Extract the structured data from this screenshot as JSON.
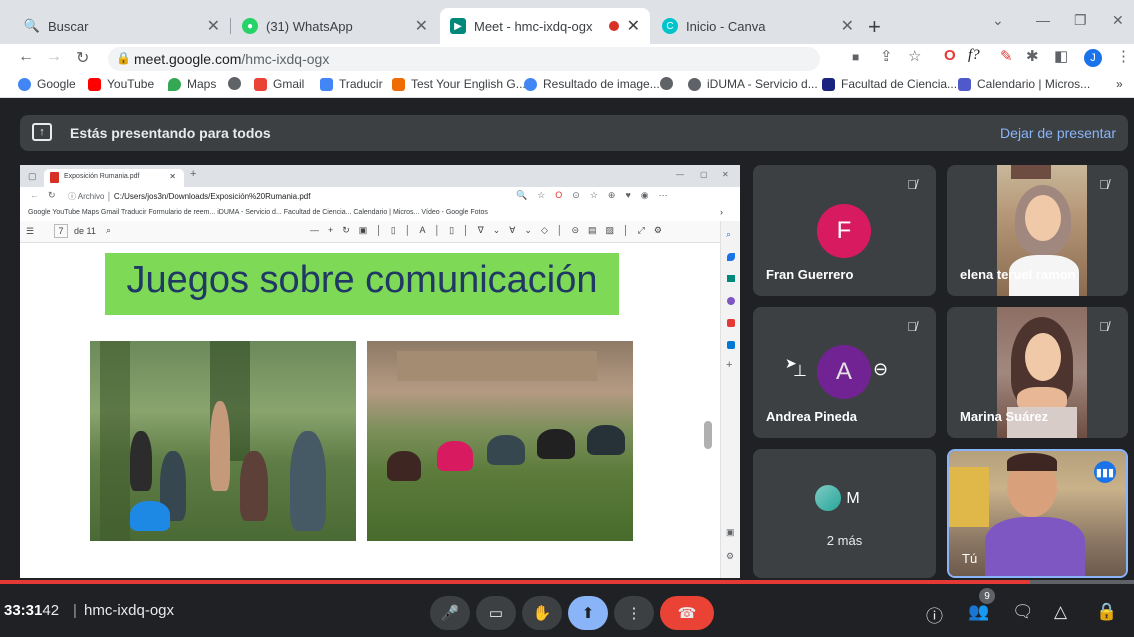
{
  "browser": {
    "tabs": [
      {
        "label": "Buscar",
        "color": "#1a73e8"
      },
      {
        "label": "(31) WhatsApp",
        "color": "#25d366"
      },
      {
        "label": "Meet - hmc-ixdq-ogx",
        "color": "#00897b"
      },
      {
        "label": "Inicio - Canva",
        "color": "#00c4cc"
      }
    ],
    "url_domain": "meet.google.com",
    "url_path": "/hmc-ixdq-ogx",
    "profile_initial": "J",
    "bookmarks": [
      "Google",
      "YouTube",
      "Maps",
      "Gmail",
      "Traducir",
      "Test Your English G...",
      "Resultado de image...",
      "iDUMA - Servicio d...",
      "Facultad de Ciencia...",
      "Calendario | Micros..."
    ]
  },
  "meet": {
    "presenting_text": "Estás presentando para todos",
    "stop_presenting": "Dejar de presentar",
    "participants": [
      {
        "name": "Fran Guerrero",
        "initial": "F",
        "color": "#d81b60"
      },
      {
        "name": "elena teruel ramon"
      },
      {
        "name": "Andrea Pineda",
        "initial": "A",
        "color": "#7b1fa2"
      },
      {
        "name": "Marina Suárez"
      },
      {
        "name": "2 más",
        "initial": "M",
        "color": "#4e342e"
      },
      {
        "name": "Tú"
      }
    ],
    "meeting_code": "hmc-ixdq-ogx",
    "time": "33:31",
    "time_overlap": "42",
    "participant_count": "9"
  },
  "shared": {
    "tab_label": "Exposición Rumania.pdf",
    "path": "C:/Users/jos3n/Downloads/Exposición%20Rumania.pdf",
    "archivo": "Archivo",
    "page_current": "7",
    "page_total": "de 11",
    "bookmarks": "Google   YouTube   Maps   Gmail   Traducir   Formulario de reem...   iDUMA - Servicio d...   Facultad de Ciencia...   Calendario | Micros...   Vídeo - Google Fotos",
    "slide_title": "Juegos sobre comunicación"
  }
}
